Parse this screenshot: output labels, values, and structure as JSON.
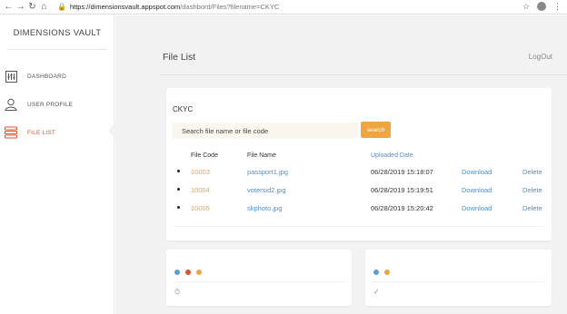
{
  "browser": {
    "url_host": "https://dimensionsvault.appspot.com",
    "url_path": "/dashbord/Files?filename=CKYC"
  },
  "sidebar": {
    "brand": "DIMENSIONS VAULT",
    "items": [
      {
        "label": "DASHBOARD",
        "icon": "dashboard-icon",
        "active": false
      },
      {
        "label": "USER PROFILE",
        "icon": "user-icon",
        "active": false
      },
      {
        "label": "FILE LIST",
        "icon": "stack-icon",
        "active": true
      }
    ]
  },
  "header": {
    "title": "File List",
    "logout": "LogOut"
  },
  "file_card": {
    "category": "CKYC",
    "search_placeholder": "Search file name or file code",
    "search_button": "search",
    "columns": {
      "code": "File Code",
      "name": "File Name",
      "uploaded": "Uploaded Date"
    },
    "rows": [
      {
        "code": "10003",
        "name": "passport1.jpg",
        "date": "06/28/2019 15:18:07",
        "download": "Download",
        "delete": "Delete"
      },
      {
        "code": "10004",
        "name": "votersid2.jpg",
        "date": "06/28/2019 15:19:51",
        "download": "Download",
        "delete": "Delete"
      },
      {
        "code": "10005",
        "name": "skphoto.jpg",
        "date": "06/28/2019 15:20:42",
        "download": "Download",
        "delete": "Delete"
      }
    ]
  },
  "mini_cards": [
    {
      "dots": [
        "#5a9fd4",
        "#d9542f",
        "#f0a640"
      ],
      "icon": "clock-icon"
    },
    {
      "dots": [
        "#5a9fd4",
        "#f0a640"
      ],
      "icon": "check-icon"
    }
  ],
  "colors": {
    "accent": "#d9542f",
    "search_button": "#f0a640",
    "link": "#4a8fd4",
    "code": "#e0a65a",
    "main_bg": "#f2f2f2"
  }
}
